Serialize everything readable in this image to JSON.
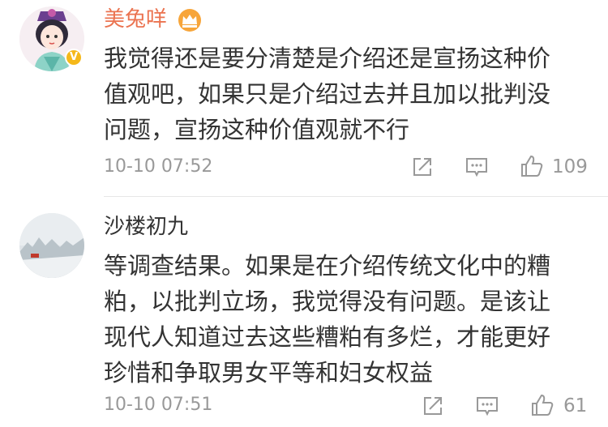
{
  "comments": [
    {
      "username": "美兔咩",
      "lines": [
        "我觉得还是要分清楚是介绍还是宣扬这种价",
        "值观吧，如果只是介绍过去并且加以批判没",
        "问题，宣扬这种价值观就不行"
      ],
      "time": "10-10 07:52",
      "likes": "109"
    },
    {
      "username": "沙楼初九",
      "lines": [
        "等调查结果。如果是在介绍传统文化中的糟",
        "粕，以批判立场，我觉得没有问题。是该让",
        "现代人知道过去这些糟粕有多烂，才能更好",
        "珍惜和争取男女平等和妇女权益"
      ],
      "time": "10-10 07:51",
      "likes": "61"
    }
  ],
  "colors": {
    "vip_name": "#eb7350",
    "text": "#333333",
    "meta": "#999999",
    "badge": "#f5b81a"
  },
  "icons": [
    "share-icon",
    "reply-icon",
    "like-icon",
    "vip-crown-icon",
    "verified-badge-icon"
  ]
}
